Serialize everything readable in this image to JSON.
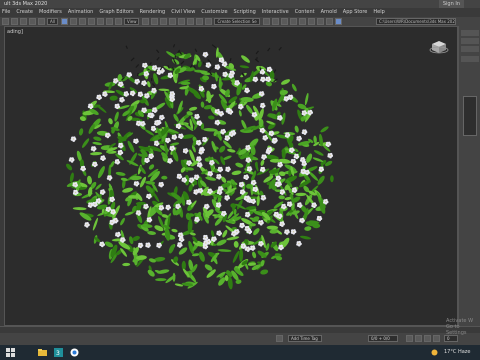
{
  "window": {
    "title": "ult 3ds Max 2020",
    "signin_label": "Sign In"
  },
  "menu": {
    "items": [
      "File",
      "Create",
      "Modifiers",
      "Animation",
      "Graph Editors",
      "Rendering",
      "Civil View",
      "Customize",
      "Scripting",
      "Interactive",
      "Content",
      "Arnold",
      "App Store",
      "Help"
    ]
  },
  "toolbar": {
    "view_dropdown": "View",
    "selection_set_dropdown": "Create Selection Se",
    "path_field": "C:\\Users\\WR\\Documents\\3ds Max 2020"
  },
  "viewport": {
    "label": "ading]"
  },
  "statusbar": {
    "add_time_tag": "Add Time Tag",
    "coord_field": "0/0 + 0/0",
    "auto_label": "Auto Key",
    "set_key_label": "Set Key",
    "frame_value": "0"
  },
  "watermark": {
    "line1": "Activate W",
    "line2": "Go to Settings"
  },
  "taskbar": {
    "temperature": "17°C",
    "condition": "Haze"
  },
  "colors": {
    "viewport_bg": "#2c2c2c",
    "leaf_dark": "#2f7d12",
    "leaf_light": "#6dc43a",
    "flower": "#e8e8f0",
    "accent": "#6a8cc8"
  }
}
